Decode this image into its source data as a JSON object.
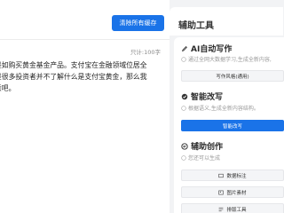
{
  "editor": {
    "clear_button": "清除所有缓存",
    "word_count": "只计:100字",
    "lines": [
      "是如购买黄金基金产品。支付宝在金融领域位居全",
      "是很多投资者并不了解什么是支付宝黄金，那么我",
      "意吧。"
    ]
  },
  "panel": {
    "title": "辅助工具",
    "ai_write": {
      "title": "AI自动写作",
      "desc": "通过全网大数据学习,生成全新内容,",
      "button": "写作风格(通用)"
    },
    "rewrite": {
      "title": "智能改写",
      "desc": "根据语义,生成全新内容结构。",
      "button": "智能改写"
    },
    "assist": {
      "title": "辅助创作",
      "desc": "您还可以生成",
      "buttons": [
        "数据标注",
        "图片素材",
        "排版工具"
      ]
    }
  },
  "colors": {
    "accent": "#1a73e8"
  }
}
